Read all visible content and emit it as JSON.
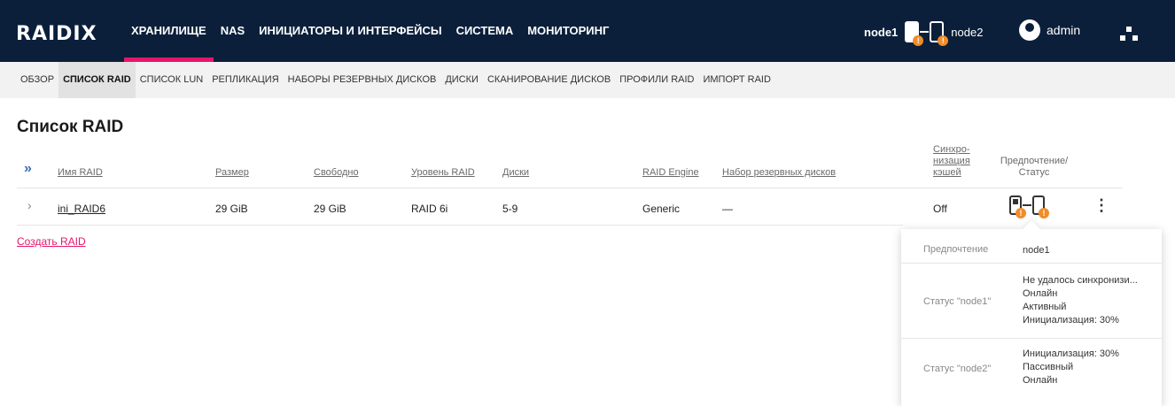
{
  "brand": "RAIDIX",
  "topnav": [
    "ХРАНИЛИЩЕ",
    "NAS",
    "ИНИЦИАТОРЫ И ИНТЕРФЕЙСЫ",
    "СИСТЕМА",
    "МОНИТОРИНГ"
  ],
  "nodes": {
    "node1": "node1",
    "node2": "node2"
  },
  "user": "admin",
  "subnav": [
    "ОБЗОР",
    "СПИСОК RAID",
    "СПИСОК LUN",
    "РЕПЛИКАЦИЯ",
    "НАБОРЫ РЕЗЕРВНЫХ ДИСКОВ",
    "ДИСКИ",
    "СКАНИРОВАНИЕ ДИСКОВ",
    "ПРОФИЛИ RAID",
    "ИМПОРТ RAID"
  ],
  "page_title": "Список RAID",
  "table": {
    "headers": {
      "name": "Имя RAID",
      "size": "Размер",
      "free": "Свободно",
      "level": "Уровень RAID",
      "disks": "Диски",
      "engine": "RAID Engine",
      "spare": "Набор резервных дисков",
      "sync_l1": "Синхро-",
      "sync_l2": "низация",
      "sync_l3": "кэшей",
      "pref_l1": "Предпочтение/",
      "pref_l2": "Статус"
    },
    "row": {
      "name": "ini_RAID6",
      "size": "29 GiB",
      "free": "29 GiB",
      "level": "RAID 6i",
      "disks": "5-9",
      "engine": "Generic",
      "spare": "—",
      "sync": "Off"
    }
  },
  "create_link": "Создать RAID",
  "popup": {
    "pref_label": "Предпочтение",
    "pref_value": "node1",
    "status1_label": "Статус \"node1\"",
    "status1_lines": [
      "Не удалось синхронизи...",
      "Онлайн",
      "Активный",
      "Инициализация: 30%"
    ],
    "status2_label": "Статус \"node2\"",
    "status2_lines": [
      "Инициализация: 30%",
      "Пассивный",
      "Онлайн"
    ]
  },
  "colors": {
    "topbar": "#0b1f3a",
    "accent": "#e5176b",
    "warning": "#f08c2a"
  }
}
